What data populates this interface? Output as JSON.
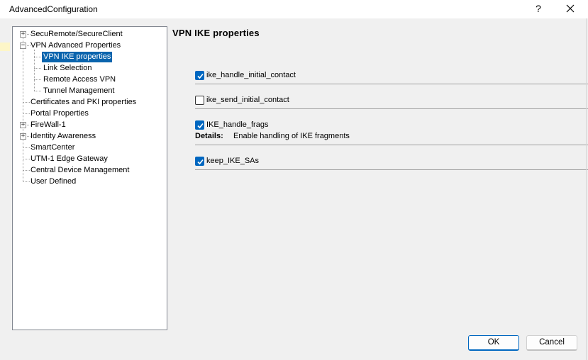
{
  "window": {
    "title": "AdvancedConfiguration",
    "help_label": "?",
    "close_label": "close"
  },
  "tree": {
    "items": [
      {
        "label": "SecuRemote/SecureClient",
        "expander": "+"
      },
      {
        "label": "VPN Advanced Properties",
        "expander": "−"
      },
      {
        "label": "VPN IKE properties",
        "selected": true
      },
      {
        "label": "Link Selection"
      },
      {
        "label": "Remote Access VPN"
      },
      {
        "label": "Tunnel Management"
      },
      {
        "label": "Certificates and PKI properties"
      },
      {
        "label": "Portal Properties"
      },
      {
        "label": "FireWall-1",
        "expander": "+"
      },
      {
        "label": "Identity Awareness",
        "expander": "+"
      },
      {
        "label": "SmartCenter"
      },
      {
        "label": "UTM-1 Edge Gateway"
      },
      {
        "label": "Central Device Management"
      },
      {
        "label": "User Defined"
      }
    ]
  },
  "panel": {
    "title": "VPN IKE properties",
    "properties": [
      {
        "name": "ike_handle_initial_contact",
        "checked": true
      },
      {
        "name": "ike_send_initial_contact",
        "checked": false
      },
      {
        "name": "IKE_handle_frags",
        "checked": true,
        "details_label": "Details:",
        "details_text": "Enable handling of IKE fragments"
      },
      {
        "name": "keep_IKE_SAs",
        "checked": true
      }
    ]
  },
  "buttons": {
    "ok": "OK",
    "cancel": "Cancel"
  },
  "colors": {
    "selection": "#0a64ad",
    "checkbox": "#0067c0",
    "dialog_bg": "#f0f0f0"
  }
}
